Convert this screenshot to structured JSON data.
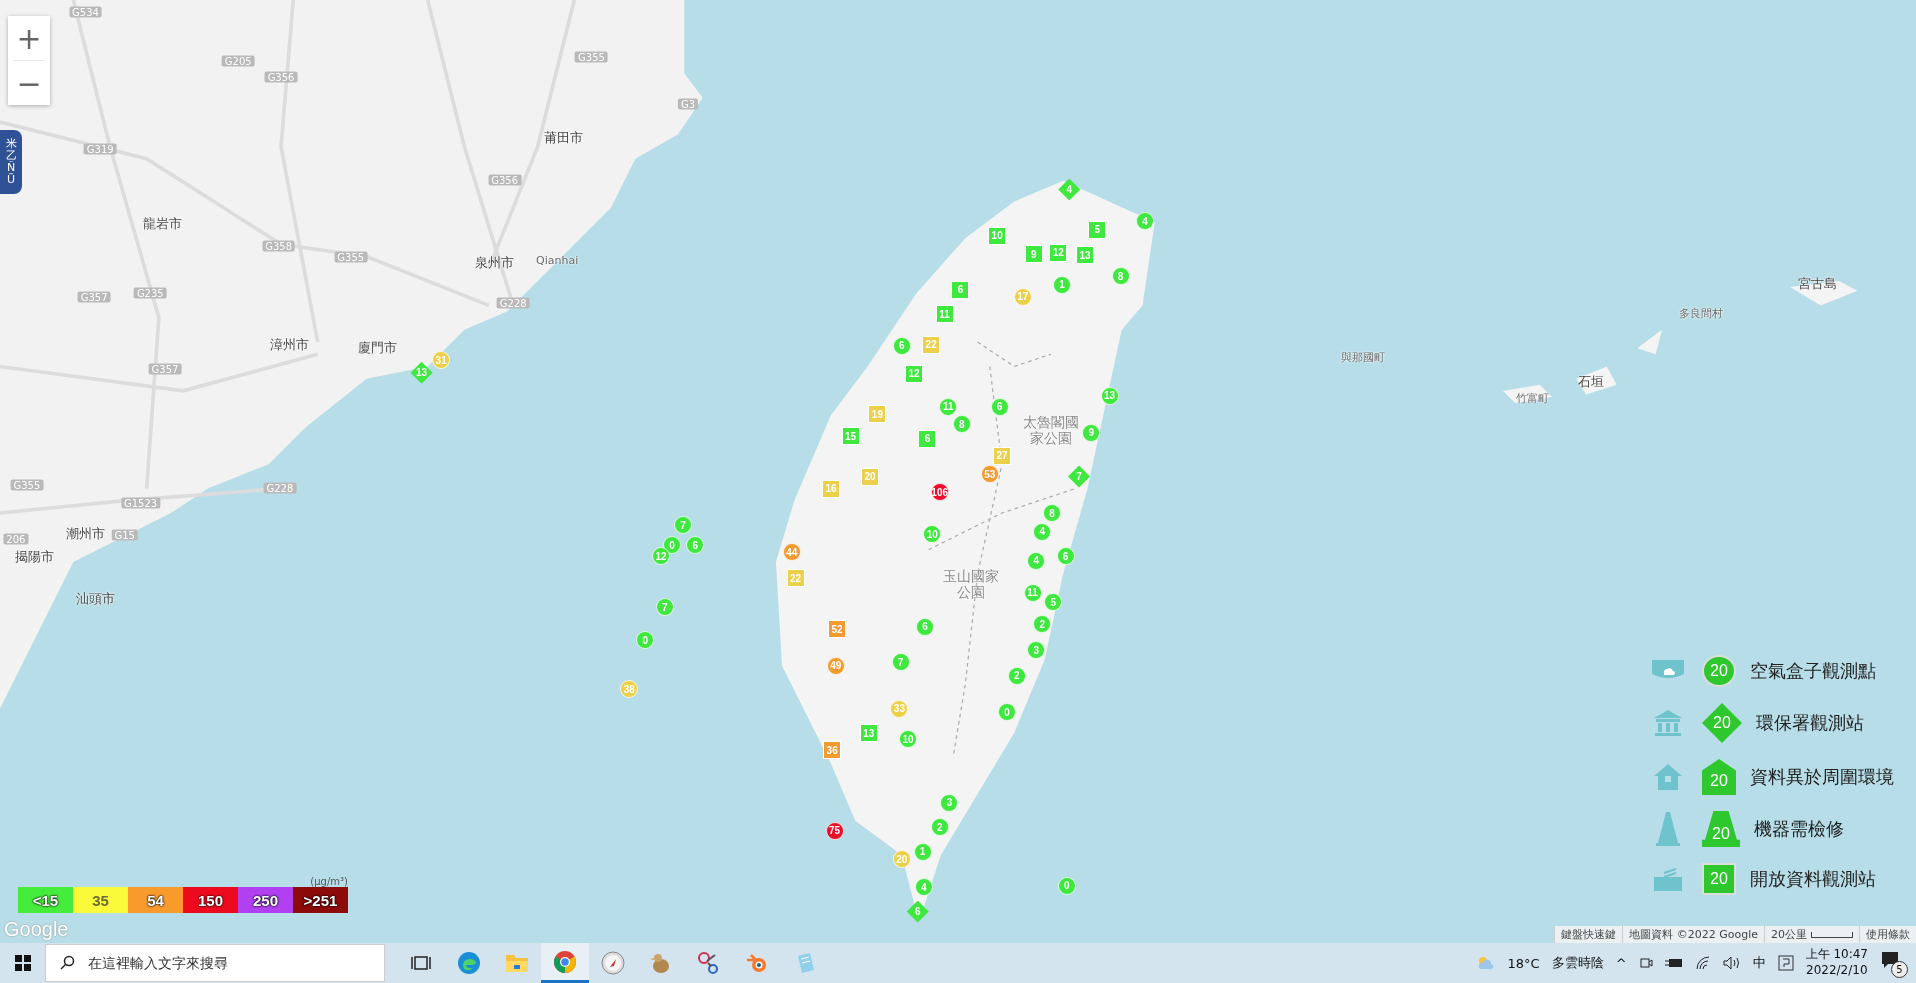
{
  "map_controls": {
    "zoom_in": "+",
    "zoom_out": "−"
  },
  "side_tab": {
    "label": "米乙ÑÜ"
  },
  "map_labels": [
    {
      "text": "莆田市",
      "kind": "city"
    },
    {
      "text": "龍岩市",
      "kind": "city"
    },
    {
      "text": "泉州市",
      "kind": "city"
    },
    {
      "text": "漳州市",
      "kind": "city"
    },
    {
      "text": "廈門市",
      "kind": "city"
    },
    {
      "text": "潮州市",
      "kind": "city"
    },
    {
      "text": "揭陽市",
      "kind": "city"
    },
    {
      "text": "汕頭市",
      "kind": "city"
    },
    {
      "text": "Qianhai",
      "kind": "place"
    },
    {
      "text": "宮古島",
      "kind": "city"
    },
    {
      "text": "多良間村",
      "kind": "place"
    },
    {
      "text": "與那國町",
      "kind": "place"
    },
    {
      "text": "竹富町",
      "kind": "place"
    },
    {
      "text": "石垣",
      "kind": "city"
    },
    {
      "text": "太魯閣國家公園",
      "kind": "park"
    },
    {
      "text": "玉山國家公園",
      "kind": "park"
    },
    {
      "text": "G534",
      "kind": "road"
    },
    {
      "text": "G205",
      "kind": "road"
    },
    {
      "text": "G356",
      "kind": "road"
    },
    {
      "text": "G319",
      "kind": "road"
    },
    {
      "text": "G358",
      "kind": "road"
    },
    {
      "text": "G235",
      "kind": "road"
    },
    {
      "text": "G357",
      "kind": "road"
    },
    {
      "text": "G355",
      "kind": "road"
    },
    {
      "text": "G228",
      "kind": "road"
    },
    {
      "text": "G3",
      "kind": "road"
    },
    {
      "text": "G355",
      "kind": "road"
    },
    {
      "text": "G356",
      "kind": "road"
    },
    {
      "text": "G1523",
      "kind": "road"
    },
    {
      "text": "G15",
      "kind": "road"
    },
    {
      "text": "206",
      "kind": "road"
    },
    {
      "text": "G357",
      "kind": "road"
    },
    {
      "text": "G355",
      "kind": "road"
    },
    {
      "text": "G228",
      "kind": "road"
    }
  ],
  "markers": [
    {
      "value": "4",
      "kind": "diamond",
      "color": "#3ee83e"
    },
    {
      "value": "5",
      "kind": "square",
      "color": "#3ee83e"
    },
    {
      "value": "4",
      "kind": "circle",
      "color": "#3ee83e"
    },
    {
      "value": "10",
      "kind": "square",
      "color": "#3ee83e"
    },
    {
      "value": "9",
      "kind": "square",
      "color": "#3ee83e"
    },
    {
      "value": "12",
      "kind": "square",
      "color": "#3ee83e"
    },
    {
      "value": "13",
      "kind": "square",
      "color": "#3ee83e"
    },
    {
      "value": "17",
      "kind": "circle",
      "color": "#ecd04a"
    },
    {
      "value": "1",
      "kind": "circle",
      "color": "#3ee83e"
    },
    {
      "value": "8",
      "kind": "circle",
      "color": "#3ee83e"
    },
    {
      "value": "6",
      "kind": "square",
      "color": "#3ee83e"
    },
    {
      "value": "11",
      "kind": "square",
      "color": "#3ee83e"
    },
    {
      "value": "22",
      "kind": "square",
      "color": "#ecd04a"
    },
    {
      "value": "6",
      "kind": "circle",
      "color": "#3ee83e"
    },
    {
      "value": "12",
      "kind": "square",
      "color": "#3ee83e"
    },
    {
      "value": "11",
      "kind": "circle",
      "color": "#3ee83e"
    },
    {
      "value": "6",
      "kind": "square",
      "color": "#3ee83e"
    },
    {
      "value": "8",
      "kind": "circle",
      "color": "#3ee83e"
    },
    {
      "value": "19",
      "kind": "square",
      "color": "#ecd04a"
    },
    {
      "value": "20",
      "kind": "square",
      "color": "#ecd04a"
    },
    {
      "value": "15",
      "kind": "square",
      "color": "#3ee83e"
    },
    {
      "value": "6",
      "kind": "circle",
      "color": "#3ee83e"
    },
    {
      "value": "13",
      "kind": "circle",
      "color": "#3ee83e"
    },
    {
      "value": "9",
      "kind": "circle",
      "color": "#3ee83e"
    },
    {
      "value": "27",
      "kind": "square",
      "color": "#ecd04a"
    },
    {
      "value": "53",
      "kind": "circle",
      "color": "#f39a30"
    },
    {
      "value": "106",
      "kind": "circle",
      "color": "#e8102a"
    },
    {
      "value": "10",
      "kind": "circle",
      "color": "#3ee83e"
    },
    {
      "value": "16",
      "kind": "square",
      "color": "#ecd04a"
    },
    {
      "value": "44",
      "kind": "circle",
      "color": "#f39a30"
    },
    {
      "value": "22",
      "kind": "square",
      "color": "#ecd04a"
    },
    {
      "value": "6",
      "kind": "circle",
      "color": "#3ee83e"
    },
    {
      "value": "7",
      "kind": "circle",
      "color": "#3ee83e"
    },
    {
      "value": "33",
      "kind": "circle",
      "color": "#ecd04a"
    },
    {
      "value": "10",
      "kind": "circle",
      "color": "#3ee83e"
    },
    {
      "value": "52",
      "kind": "square",
      "color": "#f39a30"
    },
    {
      "value": "49",
      "kind": "circle",
      "color": "#f39a30"
    },
    {
      "value": "13",
      "kind": "square",
      "color": "#3ee83e"
    },
    {
      "value": "36",
      "kind": "square",
      "color": "#f39a30"
    },
    {
      "value": "75",
      "kind": "circle",
      "color": "#e8102a"
    },
    {
      "value": "3",
      "kind": "circle",
      "color": "#3ee83e"
    },
    {
      "value": "2",
      "kind": "circle",
      "color": "#3ee83e"
    },
    {
      "value": "1",
      "kind": "circle",
      "color": "#3ee83e"
    },
    {
      "value": "20",
      "kind": "circle",
      "color": "#ecd04a"
    },
    {
      "value": "4",
      "kind": "circle",
      "color": "#3ee83e"
    },
    {
      "value": "6",
      "kind": "diamond",
      "color": "#3ee83e"
    },
    {
      "value": "0",
      "kind": "circle",
      "color": "#3ee83e"
    },
    {
      "value": "3",
      "kind": "circle",
      "color": "#3ee83e"
    },
    {
      "value": "2",
      "kind": "circle",
      "color": "#3ee83e"
    },
    {
      "value": "0",
      "kind": "circle",
      "color": "#3ee83e"
    },
    {
      "value": "7",
      "kind": "diamond",
      "color": "#3ee83e"
    },
    {
      "value": "8",
      "kind": "circle",
      "color": "#3ee83e"
    },
    {
      "value": "4",
      "kind": "circle",
      "color": "#3ee83e"
    },
    {
      "value": "6",
      "kind": "circle",
      "color": "#3ee83e"
    },
    {
      "value": "4",
      "kind": "circle",
      "color": "#3ee83e"
    },
    {
      "value": "11",
      "kind": "circle",
      "color": "#3ee83e"
    },
    {
      "value": "5",
      "kind": "circle",
      "color": "#3ee83e"
    },
    {
      "value": "2",
      "kind": "circle",
      "color": "#3ee83e"
    },
    {
      "value": "7",
      "kind": "circle",
      "color": "#3ee83e"
    },
    {
      "value": "0",
      "kind": "circle",
      "color": "#3ee83e"
    },
    {
      "value": "6",
      "kind": "circle",
      "color": "#3ee83e"
    },
    {
      "value": "12",
      "kind": "circle",
      "color": "#3ee83e"
    },
    {
      "value": "7",
      "kind": "circle",
      "color": "#3ee83e"
    },
    {
      "value": "0",
      "kind": "circle",
      "color": "#3ee83e"
    },
    {
      "value": "38",
      "kind": "circle",
      "color": "#ecd04a"
    },
    {
      "value": "13",
      "kind": "diamond",
      "color": "#3ee83e"
    },
    {
      "value": "31",
      "kind": "circle",
      "color": "#ecd04a"
    }
  ],
  "legend": [
    {
      "kind": "circle",
      "value": "20",
      "label": "空氣盒子觀測點"
    },
    {
      "kind": "diamond",
      "value": "20",
      "label": "環保署觀測站"
    },
    {
      "kind": "house",
      "value": "20",
      "label": "資料異於周圍環境"
    },
    {
      "kind": "cone",
      "value": "20",
      "label": "機器需檢修"
    },
    {
      "kind": "square",
      "value": "20",
      "label": "開放資料觀測站"
    }
  ],
  "color_scale": {
    "unit": "(μg/m³)",
    "segments": [
      {
        "label": "<15",
        "color": "#46ec3c"
      },
      {
        "label": "35",
        "color": "#fafa3a"
      },
      {
        "label": "54",
        "color": "#f89a2c"
      },
      {
        "label": "150",
        "color": "#ee0a1e"
      },
      {
        "label": "250",
        "color": "#b040f0"
      },
      {
        "label": ">251",
        "color": "#8c0a0a"
      }
    ]
  },
  "google_logo": "Google",
  "attribution": [
    "鍵盤快速鍵",
    "地圖資料 ©2022 Google",
    "20公里",
    "使用條款"
  ],
  "taskbar": {
    "search_placeholder": "在這裡輸入文字來搜尋",
    "apps": [
      {
        "selected": false
      },
      {
        "selected": false
      },
      {
        "selected": false
      },
      {
        "selected": true
      },
      {
        "selected": false
      },
      {
        "selected": false
      },
      {
        "selected": false
      },
      {
        "selected": false
      },
      {
        "selected": false
      }
    ],
    "temperature": "18°C",
    "weather": "多雲時陰",
    "tray_caret": "^",
    "ime": "中",
    "time": "上午 10:47",
    "date": "2022/2/10",
    "notifications": "5"
  }
}
